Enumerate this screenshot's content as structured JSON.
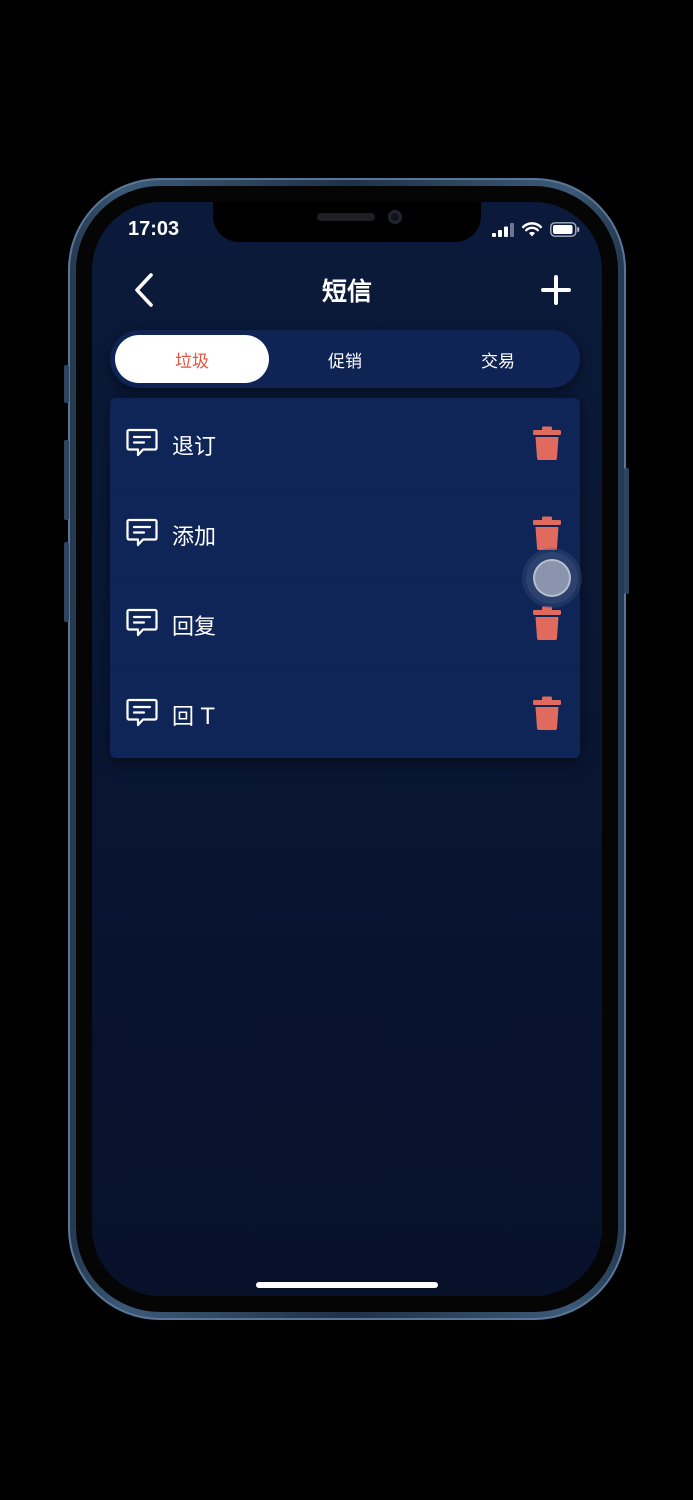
{
  "status_bar": {
    "time": "17:03",
    "signal_icon": "cellular-signal-icon",
    "wifi_icon": "wifi-icon",
    "battery_icon": "battery-icon"
  },
  "nav": {
    "title": "短信",
    "back_icon": "chevron-left-icon",
    "add_icon": "plus-icon"
  },
  "tabs": [
    {
      "label": "垃圾",
      "active": true
    },
    {
      "label": "促销",
      "active": false
    },
    {
      "label": "交易",
      "active": false
    }
  ],
  "keywords": [
    {
      "label": "退订",
      "icon": "message-icon",
      "action_icon": "trash-icon"
    },
    {
      "label": "添加",
      "icon": "message-icon",
      "action_icon": "trash-icon"
    },
    {
      "label": "回复",
      "icon": "message-icon",
      "action_icon": "trash-icon"
    },
    {
      "label": "回 T",
      "icon": "message-icon",
      "action_icon": "trash-icon"
    }
  ],
  "colors": {
    "accent": "#e2543e",
    "trash": "#e06a5e",
    "background": "#0a1835",
    "card": "#0f2558"
  }
}
